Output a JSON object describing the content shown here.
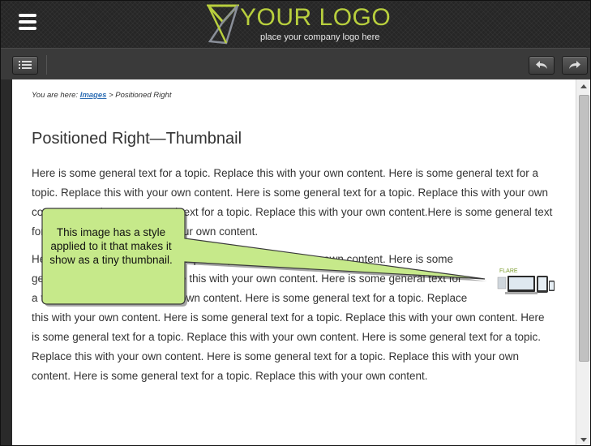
{
  "header": {
    "logo_text": "YOUR LOGO",
    "logo_tagline": "place your company logo here",
    "colors": {
      "logo_accent": "#b8cf3d",
      "header_bg": "#262626"
    }
  },
  "toolbar": {
    "toc_icon": "list-icon",
    "back_icon": "arrow-back-icon",
    "forward_icon": "arrow-forward-icon"
  },
  "breadcrumb": {
    "prefix": "You are here:",
    "link": "Images",
    "separator": ">",
    "current": "Positioned Right"
  },
  "topic": {
    "title": "Positioned Right—Thumbnail",
    "paragraph1": "Here is some general text for a topic. Replace this with your own content. Here is some general text for a topic. Replace this with your own content. Here is some general text for a topic. Replace this with your own content. Here is some general text for a topic. Replace this with your own content.Here is some general text for a topic. Replace this with your own content.",
    "paragraph2": "Here is some general text for a topic. Replace this with your own content. Here is some general text for a topic. Replace this with your own content. Here is some general text for a topic. Replace this with your own content. Here is some general text for a topic. Replace this with your own content. Here is some general text for a topic. Replace this with your own content. Here is some general text for a topic. Replace this with your own content. Here is some general text for a topic. Replace this with your own content. Here is some general text for a topic. Replace this with your own content. Here is some general text for a topic. Replace this with your own content.",
    "thumbnail_label": "FLARE"
  },
  "callout": {
    "text": "This image has a style applied to it that makes it show as a tiny thumbnail.",
    "color": "#c6e98a"
  }
}
